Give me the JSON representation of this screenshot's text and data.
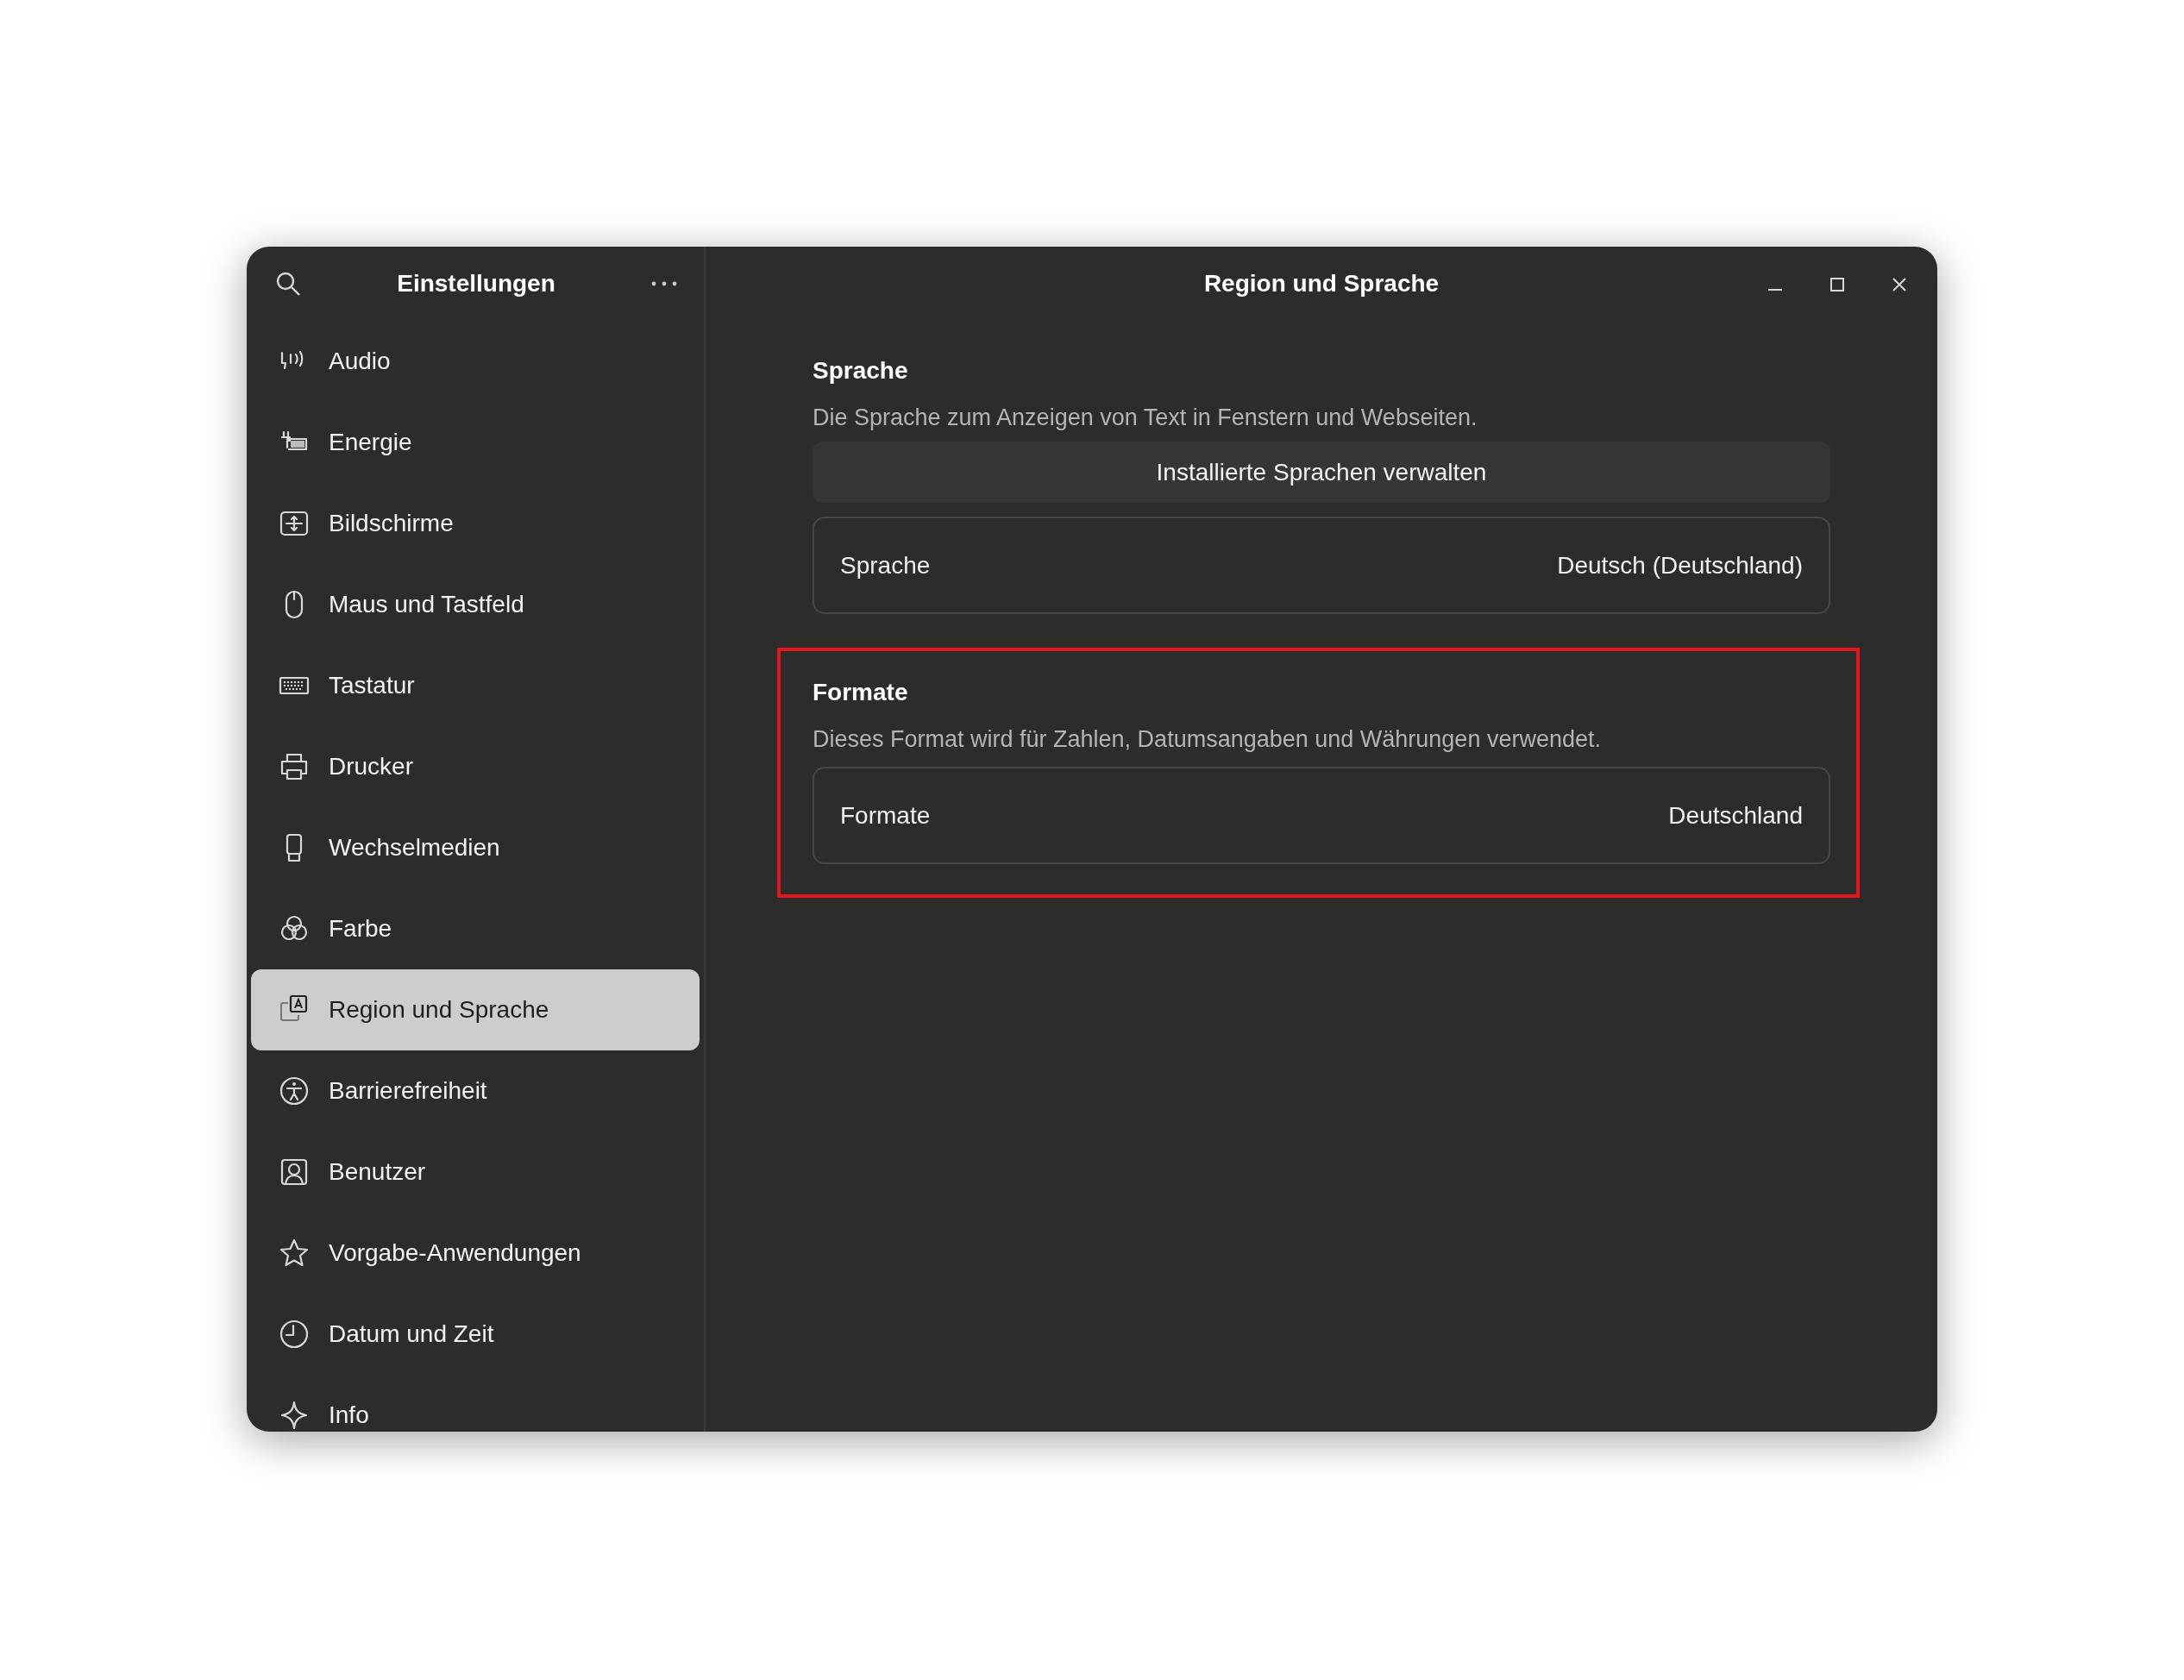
{
  "sidebar": {
    "title": "Einstellungen",
    "items": [
      {
        "label": "Audio",
        "selected": false
      },
      {
        "label": "Energie",
        "selected": false
      },
      {
        "label": "Bildschirme",
        "selected": false
      },
      {
        "label": "Maus und Tastfeld",
        "selected": false
      },
      {
        "label": "Tastatur",
        "selected": false
      },
      {
        "label": "Drucker",
        "selected": false
      },
      {
        "label": "Wechselmedien",
        "selected": false
      },
      {
        "label": "Farbe",
        "selected": false
      },
      {
        "label": "Region und Sprache",
        "selected": true
      },
      {
        "label": "Barrierefreiheit",
        "selected": false
      },
      {
        "label": "Benutzer",
        "selected": false
      },
      {
        "label": "Vorgabe-Anwendungen",
        "selected": false
      },
      {
        "label": "Datum und Zeit",
        "selected": false
      },
      {
        "label": "Info",
        "selected": false
      }
    ]
  },
  "page": {
    "title": "Region und Sprache",
    "sections": [
      {
        "heading": "Sprache",
        "description": "Die Sprache zum Anzeigen von Text in Fenstern und Webseiten.",
        "highlighted": false,
        "button": "Installierte Sprachen verwalten",
        "rows": [
          {
            "label": "Sprache",
            "value": "Deutsch (Deutschland)"
          }
        ]
      },
      {
        "heading": "Formate",
        "description": "Dieses Format wird für Zahlen, Datumsangaben und Währungen verwendet.",
        "highlighted": true,
        "rows": [
          {
            "label": "Formate",
            "value": "Deutschland"
          }
        ]
      }
    ]
  }
}
